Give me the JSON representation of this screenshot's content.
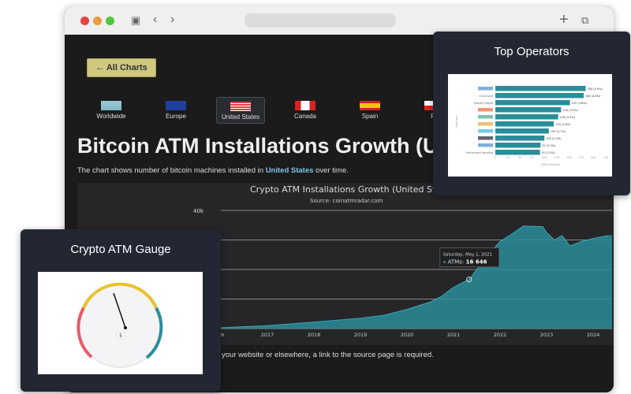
{
  "browser": {
    "colors": {
      "close": "#e8443f",
      "min": "#eb9a3d",
      "max": "#4fc63d"
    }
  },
  "page": {
    "back_label": "← All Charts",
    "regions": [
      {
        "label": "Worldwide"
      },
      {
        "label": "Europe"
      },
      {
        "label": "United States",
        "selected": true
      },
      {
        "label": "Canada"
      },
      {
        "label": "Spain"
      },
      {
        "label": "Po"
      }
    ],
    "title": "Bitcoin ATM Installations Growth (U",
    "desc_pre": "The chart shows number of bitcoin machines installed in ",
    "desc_country": "United States",
    "desc_post": " over time.",
    "note": "your website or elsewhere, a link to the source page is required."
  },
  "chart_data": {
    "type": "area",
    "title": "Crypto ATM Installations Growth (United Sta",
    "subtitle": "Source: coinatmradar.com",
    "x_ticks": [
      "16",
      "2017",
      "2018",
      "2019",
      "2020",
      "2021",
      "2022",
      "2023",
      "2024"
    ],
    "y_ticks": [
      "40k"
    ],
    "ylim": [
      0,
      40000
    ],
    "color": "#2a8d9a",
    "x": [
      "2016-01",
      "2017-01",
      "2018-01",
      "2019-01",
      "2019-07",
      "2020-01",
      "2020-07",
      "2020-10",
      "2021-01",
      "2021-05",
      "2021-07",
      "2021-10",
      "2022-01",
      "2022-04",
      "2022-07",
      "2022-12",
      "2023-01",
      "2023-03",
      "2023-05",
      "2023-07",
      "2023-10",
      "2024-01",
      "2024-05"
    ],
    "y": [
      300,
      1000,
      2200,
      3500,
      4500,
      6500,
      9000,
      11000,
      14000,
      16646,
      20000,
      25000,
      29500,
      32000,
      34700,
      34500,
      32500,
      30000,
      31500,
      28000,
      29500,
      30500,
      31500
    ],
    "tooltip": {
      "date": "Saturday, May 1, 2021",
      "label": "ATMs:",
      "value": "16 646"
    }
  },
  "operators": {
    "title": "Top Operators",
    "ylabel": "Operator",
    "xlabel": "ATMs Number",
    "labels": [
      "",
      "CoinCloud",
      "Bitcoin Depot",
      "",
      "",
      "",
      "",
      "",
      "",
      "Unlicensed Vending"
    ],
    "values": [
      184,
      180,
      152,
      134,
      128,
      119,
      109,
      100,
      92,
      91
    ],
    "value_labels": [
      "184 (4.9%)",
      "180 (4.8%)",
      "152 (3.8%)",
      "134 (3.5%)",
      "128 (3.3%)",
      "119 (2.8%)",
      "109 (2.7%)",
      "100 (2.5%)",
      "92 (2.3%)",
      "91 (2.3%)"
    ],
    "ticks": [
      "0",
      "25",
      "50",
      "75",
      "100",
      "125",
      "150",
      "175",
      "200",
      "225"
    ],
    "color": "#2a8d9a"
  },
  "gauge": {
    "title": "Crypto ATM Gauge",
    "value": "5",
    "colors": {
      "low": "#e85a6a",
      "mid": "#e8c22a",
      "high": "#2a8d9a"
    }
  }
}
